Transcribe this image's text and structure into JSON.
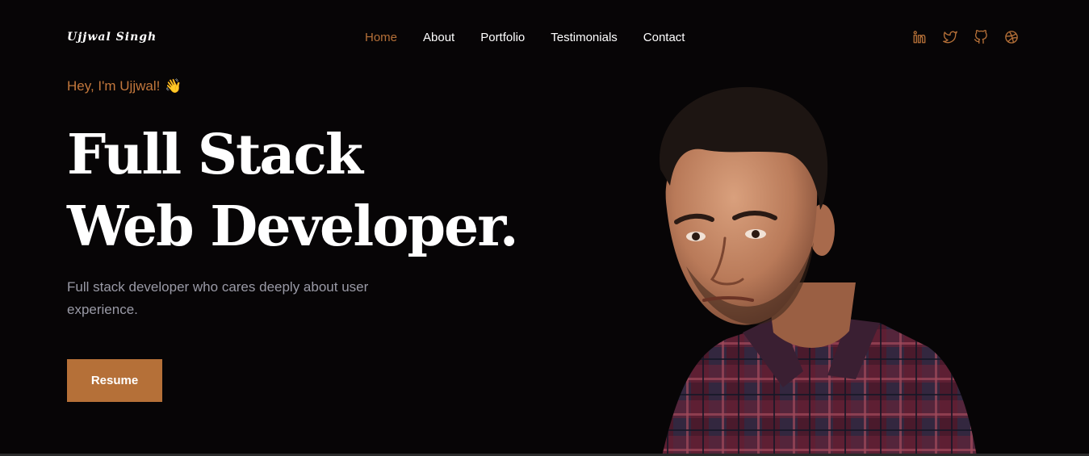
{
  "header": {
    "brand": "Ujjwal Singh",
    "nav": [
      {
        "label": "Home",
        "active": true
      },
      {
        "label": "About",
        "active": false
      },
      {
        "label": "Portfolio",
        "active": false
      },
      {
        "label": "Testimonials",
        "active": false
      },
      {
        "label": "Contact",
        "active": false
      }
    ],
    "socials": [
      "linkedin-icon",
      "twitter-icon",
      "github-icon",
      "dribbble-icon"
    ]
  },
  "hero": {
    "greeting": "Hey, I'm Ujjwal!",
    "greeting_emoji": "👋",
    "headline_line1": "Full Stack",
    "headline_line2": "Web Developer.",
    "subtitle": "Full stack developer who cares deeply about user experience.",
    "resume_label": "Resume"
  },
  "colors": {
    "background": "#070506",
    "accent": "#b57038",
    "text": "#ffffff",
    "muted": "#9a9aa6"
  }
}
